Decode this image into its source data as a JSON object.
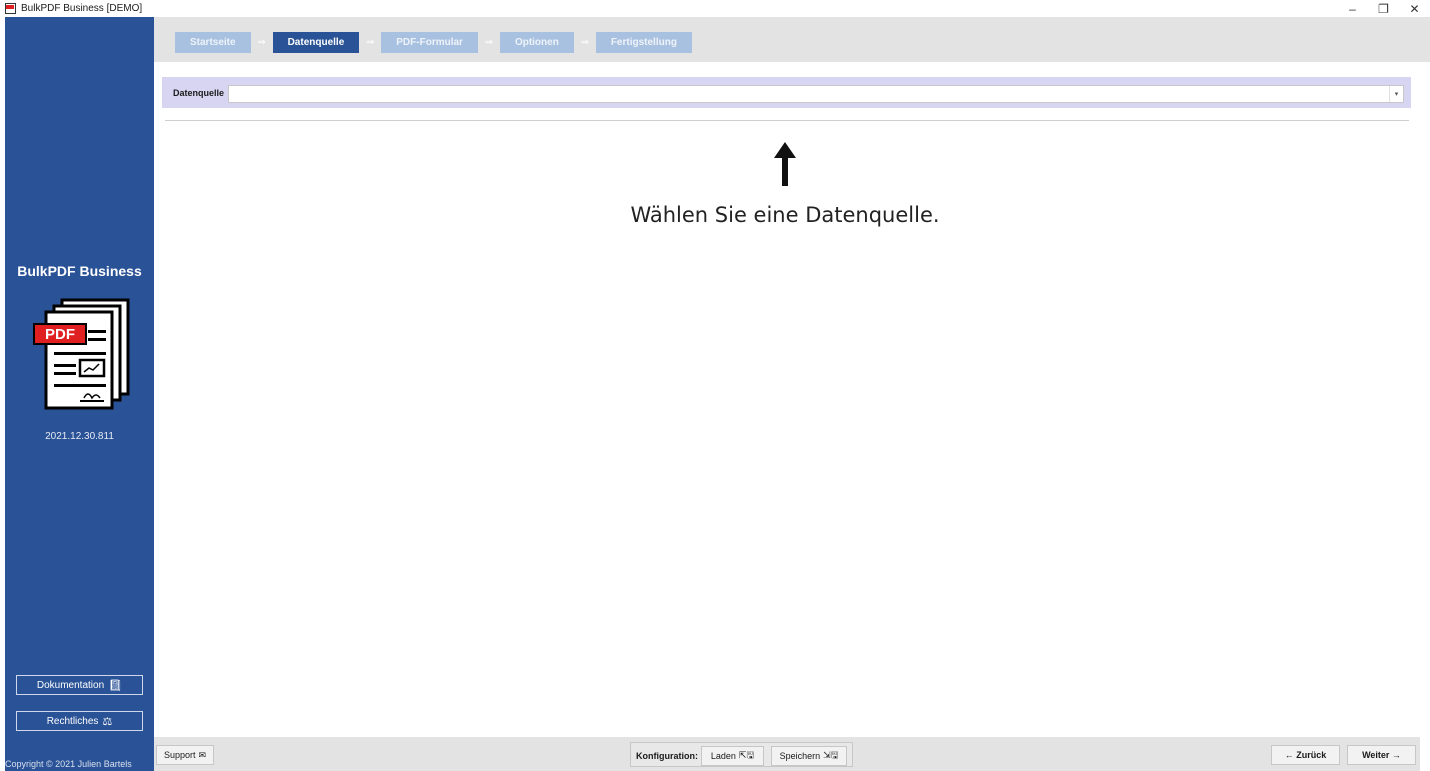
{
  "window": {
    "title": "BulkPDF Business [DEMO]",
    "controls": {
      "minimize": "–",
      "restore": "❐",
      "close": "✕"
    }
  },
  "sidebar": {
    "brand": "BulkPDF Business",
    "logo_badge": "PDF",
    "version": "2021.12.30.811",
    "buttons": [
      {
        "label": "Dokumentation",
        "icon": "book-icon"
      },
      {
        "label": "Rechtliches",
        "icon": "scales-icon"
      }
    ],
    "copyright": "Copyright © 2021 Julien Bartels"
  },
  "wizard": {
    "steps": [
      {
        "label": "Startseite",
        "active": false
      },
      {
        "label": "Datenquelle",
        "active": true
      },
      {
        "label": "PDF-Formular",
        "active": false
      },
      {
        "label": "Optionen",
        "active": false
      },
      {
        "label": "Fertigstellung",
        "active": false
      }
    ],
    "separator": "⇒"
  },
  "datasource": {
    "label": "Datenquelle",
    "value": "",
    "caret": "▾"
  },
  "hint": {
    "text": "Wählen Sie eine Datenquelle."
  },
  "bottombar": {
    "support_label": "Support",
    "config_label": "Konfiguration:",
    "load_label": "Laden",
    "save_label": "Speichern",
    "back_label": "← Zurück",
    "next_label": "Weiter →"
  },
  "colors": {
    "sidebar": "#2a5296",
    "step_active": "#2a5296",
    "step_inactive": "#a9c1e0",
    "datasource_band": "#d8d5f2",
    "logo_badge": "#e02020"
  }
}
